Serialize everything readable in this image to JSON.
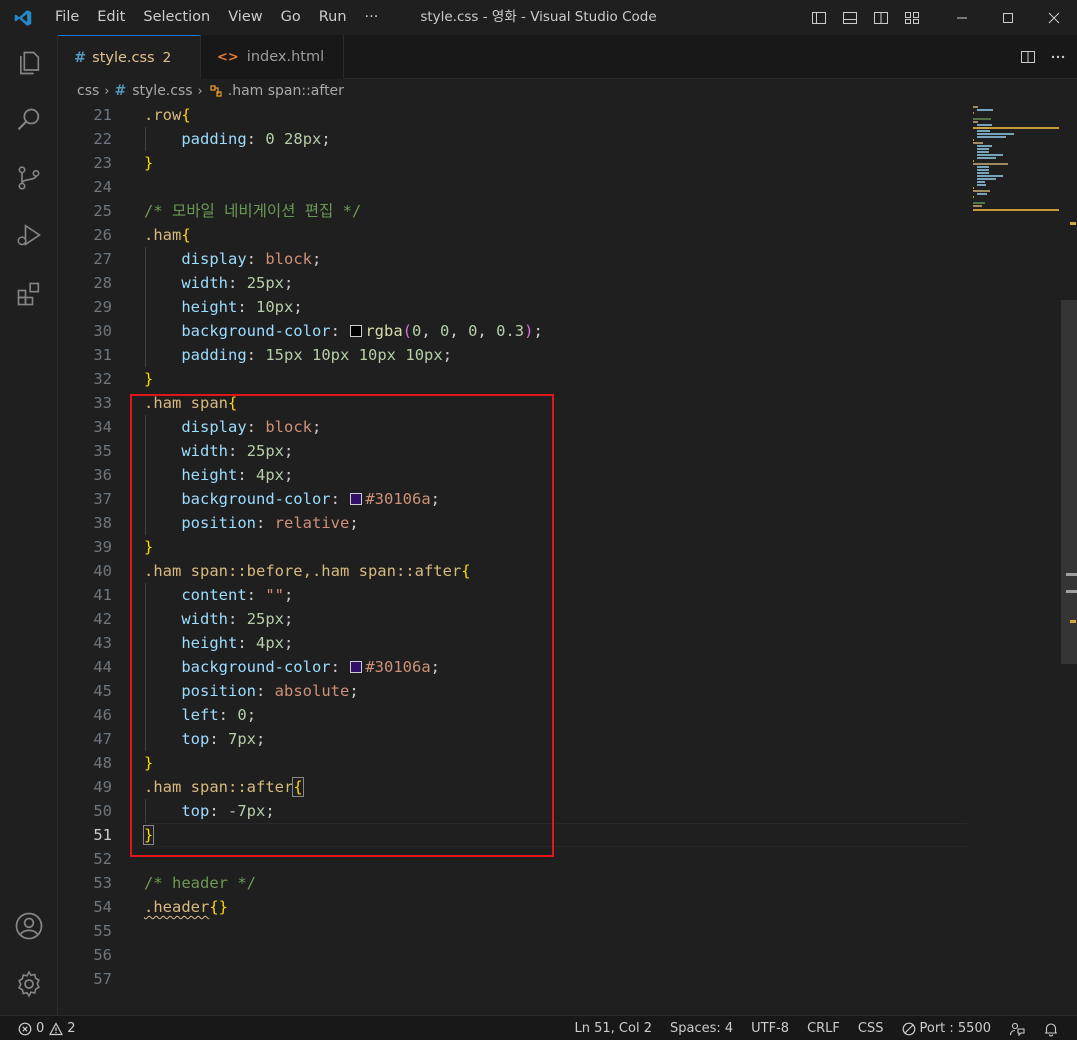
{
  "titlebar": {
    "menu": [
      "File",
      "Edit",
      "Selection",
      "View",
      "Go",
      "Run",
      "···"
    ],
    "title": "style.css - 영화 - Visual Studio Code"
  },
  "tabs": [
    {
      "icon": "#",
      "label": "style.css",
      "badge": "2",
      "active": true
    },
    {
      "icon": "<>",
      "label": "index.html",
      "active": false
    }
  ],
  "breadcrumb": {
    "folder": "css",
    "file_icon": "#",
    "file": "style.css",
    "symbol": ".ham span::after"
  },
  "editor": {
    "current_line": 51,
    "lines": [
      {
        "n": "21",
        "text": ".row{"
      },
      {
        "n": "22",
        "text": "    padding: 0 28px;"
      },
      {
        "n": "23",
        "text": "}"
      },
      {
        "n": "24",
        "text": ""
      },
      {
        "n": "25",
        "text": "/* 모바일 네비게이션 편집 */"
      },
      {
        "n": "26",
        "text": ".ham{"
      },
      {
        "n": "27",
        "text": "    display: block;"
      },
      {
        "n": "28",
        "text": "    width: 25px;"
      },
      {
        "n": "29",
        "text": "    height: 10px;"
      },
      {
        "n": "30",
        "text": "    background-color: rgba(0, 0, 0, 0.3);"
      },
      {
        "n": "31",
        "text": "    padding: 15px 10px 10px 10px;"
      },
      {
        "n": "32",
        "text": "}"
      },
      {
        "n": "33",
        "text": ".ham span{"
      },
      {
        "n": "34",
        "text": "    display: block;"
      },
      {
        "n": "35",
        "text": "    width: 25px;"
      },
      {
        "n": "36",
        "text": "    height: 4px;"
      },
      {
        "n": "37",
        "text": "    background-color: #30106a;"
      },
      {
        "n": "38",
        "text": "    position: relative;"
      },
      {
        "n": "39",
        "text": "}"
      },
      {
        "n": "40",
        "text": ".ham span::before,.ham span::after{"
      },
      {
        "n": "41",
        "text": "    content: \"\";"
      },
      {
        "n": "42",
        "text": "    width: 25px;"
      },
      {
        "n": "43",
        "text": "    height: 4px;"
      },
      {
        "n": "44",
        "text": "    background-color: #30106a;"
      },
      {
        "n": "45",
        "text": "    position: absolute;"
      },
      {
        "n": "46",
        "text": "    left: 0;"
      },
      {
        "n": "47",
        "text": "    top: 7px;"
      },
      {
        "n": "48",
        "text": "}"
      },
      {
        "n": "49",
        "text": ".ham span::after{"
      },
      {
        "n": "50",
        "text": "    top: -7px;"
      },
      {
        "n": "51",
        "text": "}"
      },
      {
        "n": "52",
        "text": ""
      },
      {
        "n": "53",
        "text": "/* header */"
      },
      {
        "n": "54",
        "text": ".header{}"
      },
      {
        "n": "55",
        "text": ""
      },
      {
        "n": "56",
        "text": ""
      },
      {
        "n": "57",
        "text": ""
      }
    ],
    "swatch_colors": {
      "rgba_black": "#000000",
      "purple": "#30106a"
    }
  },
  "statusbar": {
    "errors": "0",
    "warnings": "2",
    "position": "Ln 51, Col 2",
    "spaces": "Spaces: 4",
    "encoding": "UTF-8",
    "eol": "CRLF",
    "language": "CSS",
    "port": "Port : 5500"
  },
  "colors": {
    "accent": "#0078d4",
    "highlight_box": "#e0161a"
  }
}
